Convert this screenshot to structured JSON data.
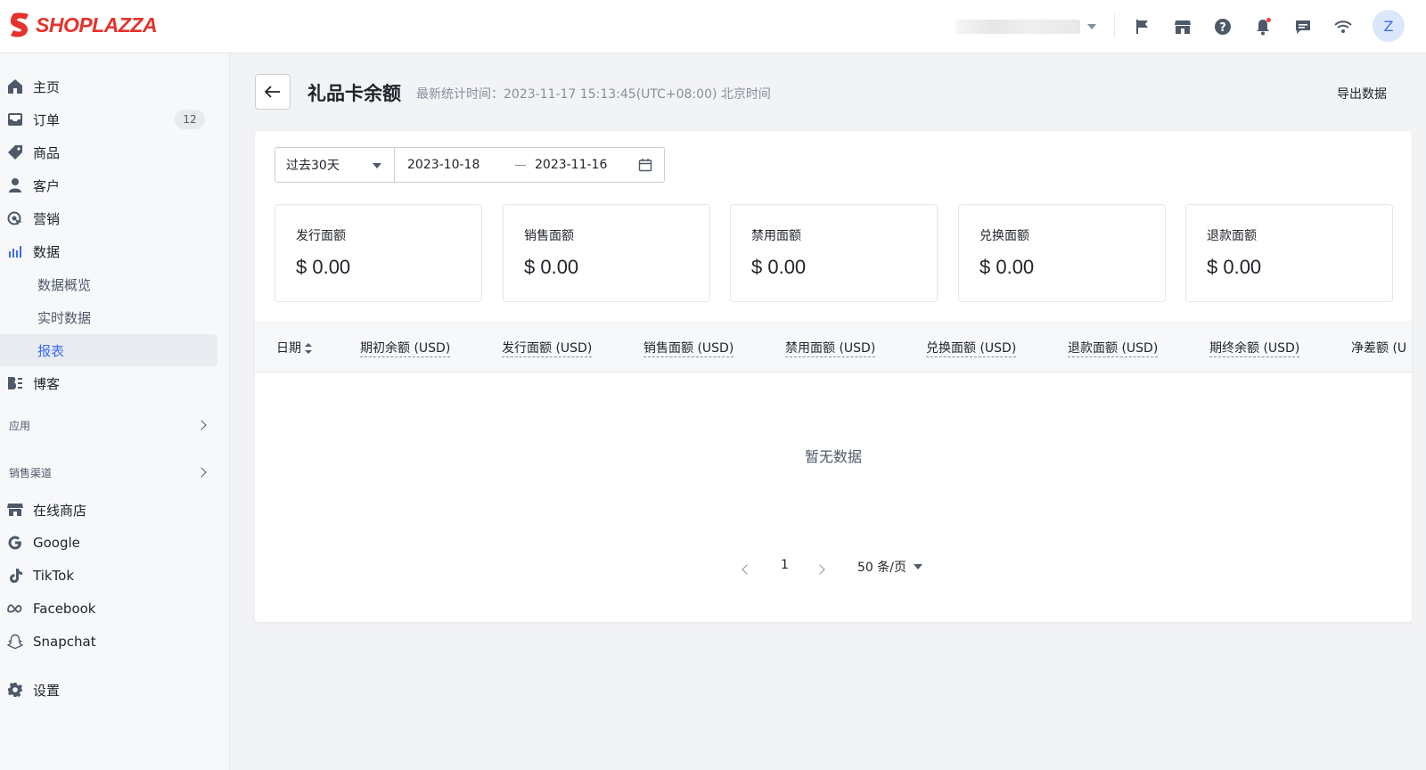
{
  "brand": {
    "name": "SHOPLAZZA",
    "color": "#e5322d"
  },
  "topbar": {
    "icons": [
      "flag-icon",
      "store-icon",
      "help-icon",
      "bell-icon",
      "message-icon",
      "wifi-icon"
    ],
    "avatar_initial": "Z"
  },
  "sidebar": {
    "items": [
      {
        "key": "home",
        "label": "主页",
        "icon": "home-icon"
      },
      {
        "key": "orders",
        "label": "订单",
        "icon": "inbox-icon",
        "badge": "12"
      },
      {
        "key": "products",
        "label": "商品",
        "icon": "tag-icon"
      },
      {
        "key": "customers",
        "label": "客户",
        "icon": "person-icon"
      },
      {
        "key": "marketing",
        "label": "营销",
        "icon": "marketing-icon"
      },
      {
        "key": "data",
        "label": "数据",
        "icon": "bar-chart-icon"
      }
    ],
    "data_sub": [
      "数据概览",
      "实时数据",
      "报表"
    ],
    "blog": "博客",
    "apps_section": "应用",
    "channels_section": "销售渠道",
    "channels": [
      "在线商店",
      "Google",
      "TikTok",
      "Facebook",
      "Snapchat"
    ],
    "settings": "设置"
  },
  "header": {
    "title": "礼品卡余额",
    "updated": "最新统计时间：2023-11-17 15:13:45(UTC+08:00) 北京时间",
    "export": "导出数据"
  },
  "filters": {
    "range": "过去30天",
    "start_date": "2023-10-18",
    "end_date": "2023-11-16"
  },
  "stats": [
    {
      "label": "发行面额",
      "value": "$ 0.00"
    },
    {
      "label": "销售面额",
      "value": "$ 0.00"
    },
    {
      "label": "禁用面额",
      "value": "$ 0.00"
    },
    {
      "label": "兑换面额",
      "value": "$ 0.00"
    },
    {
      "label": "退款面额",
      "value": "$ 0.00"
    }
  ],
  "table": {
    "columns": [
      "日期",
      "期初余额 (USD)",
      "发行面额 (USD)",
      "销售面额 (USD)",
      "禁用面额 (USD)",
      "兑换面额 (USD)",
      "退款面额 (USD)",
      "期终余额 (USD)",
      "净差额 (U"
    ],
    "empty": "暂无数据"
  },
  "pagination": {
    "page": "1",
    "page_size": "50 条/页"
  }
}
